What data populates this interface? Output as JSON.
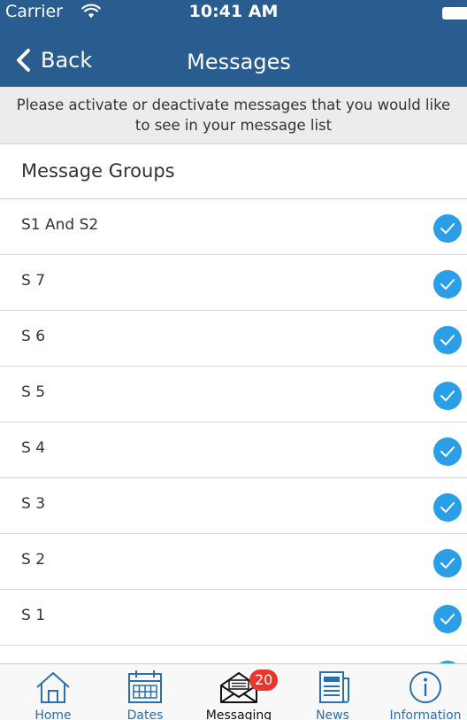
{
  "status_bar": {
    "carrier": "Carrier",
    "time": "10:41 AM"
  },
  "nav": {
    "back_label": "Back",
    "title": "Messages"
  },
  "instructions": "Please activate or deactivate messages that you would like to see in your message list",
  "section_title": "Message Groups",
  "groups": [
    {
      "label": "S1 And S2",
      "checked": true
    },
    {
      "label": "S 7",
      "checked": true
    },
    {
      "label": "S 6",
      "checked": true
    },
    {
      "label": "S 5",
      "checked": true
    },
    {
      "label": "S 4",
      "checked": true
    },
    {
      "label": "S 3",
      "checked": true
    },
    {
      "label": "S 2",
      "checked": true
    },
    {
      "label": "S 1",
      "checked": true
    },
    {
      "label": "",
      "checked": true
    }
  ],
  "tabs": [
    {
      "label": "Home",
      "icon": "home-icon"
    },
    {
      "label": "Dates",
      "icon": "calendar-icon"
    },
    {
      "label": "Messaging",
      "icon": "envelope-icon",
      "badge": "20",
      "active": true
    },
    {
      "label": "News",
      "icon": "newspaper-icon"
    },
    {
      "label": "Information",
      "icon": "info-icon"
    }
  ],
  "colors": {
    "header": "#2a5d8f",
    "check": "#2a9ee6",
    "tab_accent": "#2a6fb0",
    "badge": "#e8362c"
  }
}
